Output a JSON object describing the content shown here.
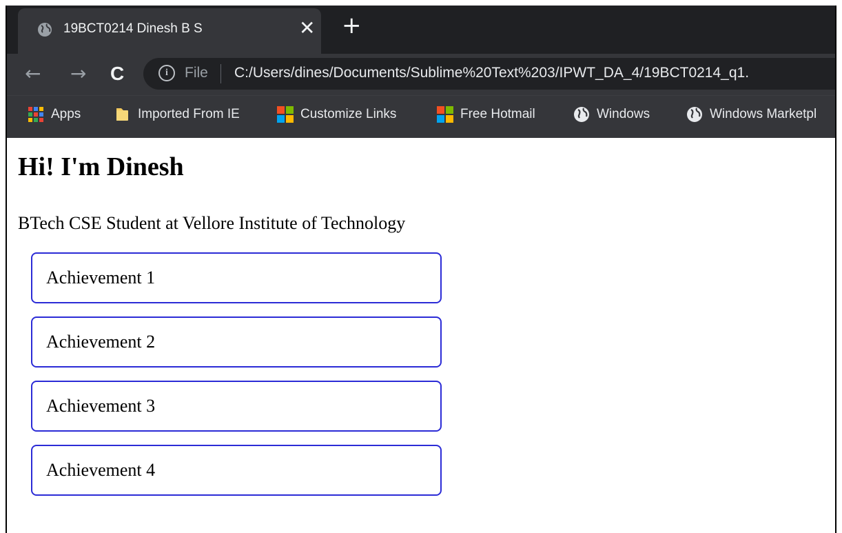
{
  "browser": {
    "tab": {
      "title": "19BCT0214 Dinesh B S",
      "close_glyph": "✕",
      "icon": "globe-icon"
    },
    "new_tab_glyph": "+",
    "toolbar": {
      "back_glyph": "←",
      "forward_glyph": "→",
      "reload_glyph": "C",
      "info_glyph": "i",
      "scheme_label": "File",
      "url": "C:/Users/dines/Documents/Sublime%20Text%203/IPWT_DA_4/19BCT0214_q1."
    },
    "bookmarks": [
      {
        "label": "Apps",
        "icon": "apps-grid-icon"
      },
      {
        "label": "Imported From IE",
        "icon": "folder-icon"
      },
      {
        "label": "Customize Links",
        "icon": "windows-logo-icon"
      },
      {
        "label": "Free Hotmail",
        "icon": "windows-logo-icon"
      },
      {
        "label": "Windows",
        "icon": "globe-icon"
      },
      {
        "label": "Windows Marketpl",
        "icon": "globe-icon"
      }
    ]
  },
  "page": {
    "heading": "Hi! I'm Dinesh",
    "subtitle": "BTech CSE Student at Vellore Institute of Technology",
    "achievements": [
      "Achievement 1",
      "Achievement 2",
      "Achievement 3",
      "Achievement 4"
    ]
  },
  "colors": {
    "card_border": "#2b2bd6",
    "chrome_dark": "#35363a",
    "tabstrip": "#1f2023"
  }
}
